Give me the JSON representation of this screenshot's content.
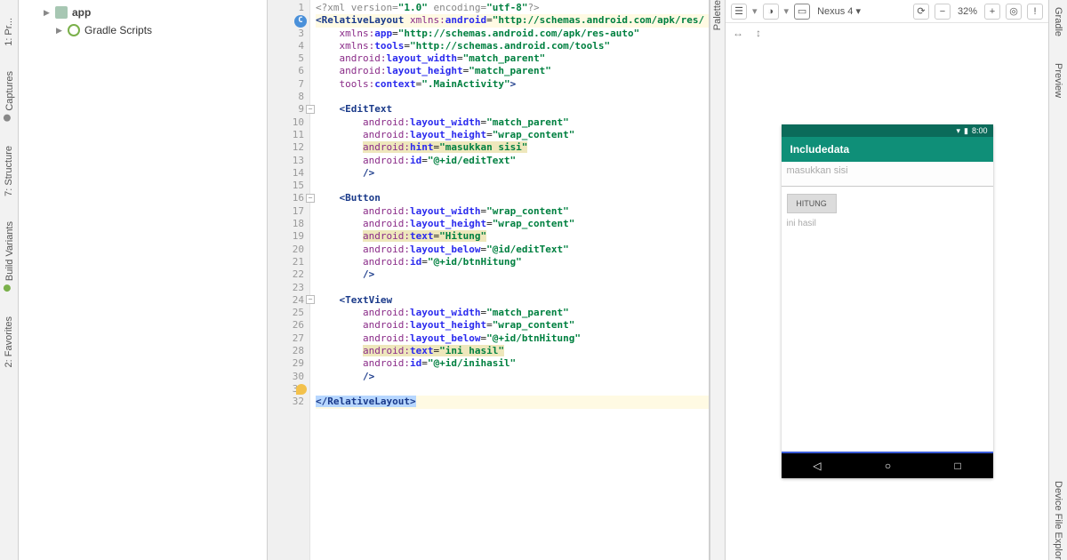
{
  "left_tabs": {
    "project": "1: Pr...",
    "captures": "Captures",
    "structure": "7: Structure",
    "build_variants": "Build Variants",
    "favorites": "2: Favorites"
  },
  "tree": {
    "app": "app",
    "gradle": "Gradle Scripts"
  },
  "palette": "Palette",
  "right_tabs": {
    "gradle": "Gradle",
    "preview": "Preview",
    "explorer": "Device File Explor"
  },
  "toolbar": {
    "device": "Nexus 4",
    "zoom": "32%",
    "layers_icon": "layers",
    "view_icon": "view",
    "phone_icon": "phone"
  },
  "preview": {
    "time": "8:00",
    "app_title": "Includedata",
    "hint": "masukkan sisi",
    "button": "HITUNG",
    "result": "ini hasil"
  },
  "code_lines": [
    {
      "n": 1,
      "html": "<span class='gr'>&lt;?xml version=</span><span class='val'>\"1.0\"</span><span class='gr'> encoding=</span><span class='val'>\"utf-8\"</span><span class='gr'>?&gt;</span>"
    },
    {
      "n": 2,
      "html": "<span class='tag'>&lt;RelativeLayout</span> <span class='attr-ns'>xmlns:</span><span class='attr'>android</span>=<span class='val'>\"http://schemas.android.com/apk/res/</span>",
      "hl": true,
      "anno": "c"
    },
    {
      "n": 3,
      "html": "    <span class='attr-ns'>xmlns:</span><span class='attr'>app</span>=<span class='val'>\"http://schemas.android.com/apk/res-auto\"</span>"
    },
    {
      "n": 4,
      "html": "    <span class='attr-ns'>xmlns:</span><span class='attr'>tools</span>=<span class='val'>\"http://schemas.android.com/tools\"</span>"
    },
    {
      "n": 5,
      "html": "    <span class='attr-ns'>android:</span><span class='attr'>layout_width</span>=<span class='val'>\"match_parent\"</span>"
    },
    {
      "n": 6,
      "html": "    <span class='attr-ns'>android:</span><span class='attr'>layout_height</span>=<span class='val'>\"match_parent\"</span>"
    },
    {
      "n": 7,
      "html": "    <span class='attr-ns'>tools:</span><span class='attr'>context</span>=<span class='val'>\".MainActivity\"</span><span class='tag'>&gt;</span>"
    },
    {
      "n": 8,
      "html": ""
    },
    {
      "n": 9,
      "html": "    <span class='tag'>&lt;EditText</span>",
      "fold": true
    },
    {
      "n": 10,
      "html": "        <span class='attr-ns'>android:</span><span class='attr'>layout_width</span>=<span class='val'>\"match_parent\"</span>"
    },
    {
      "n": 11,
      "html": "        <span class='attr-ns'>android:</span><span class='attr'>layout_height</span>=<span class='val'>\"wrap_content\"</span>"
    },
    {
      "n": 12,
      "html": "        <span class='hint-hl'><span class='attr-ns'>android:</span><span class='attr'>hint</span>=<span class='val'>\"masukkan sisi\"</span></span>"
    },
    {
      "n": 13,
      "html": "        <span class='attr-ns'>android:</span><span class='attr'>id</span>=<span class='val'>\"@+id/editText\"</span>"
    },
    {
      "n": 14,
      "html": "        <span class='tag'>/&gt;</span>"
    },
    {
      "n": 15,
      "html": ""
    },
    {
      "n": 16,
      "html": "    <span class='tag'>&lt;Button</span>",
      "fold": true
    },
    {
      "n": 17,
      "html": "        <span class='attr-ns'>android:</span><span class='attr'>layout_width</span>=<span class='val'>\"wrap_content\"</span>"
    },
    {
      "n": 18,
      "html": "        <span class='attr-ns'>android:</span><span class='attr'>layout_height</span>=<span class='val'>\"wrap_content\"</span>"
    },
    {
      "n": 19,
      "html": "        <span class='hint-hl'><span class='attr-ns'>android:</span><span class='attr'>text</span>=<span class='val'>\"Hitung\"</span></span>"
    },
    {
      "n": 20,
      "html": "        <span class='attr-ns'>android:</span><span class='attr'>layout_below</span>=<span class='val'>\"@id/editText\"</span>"
    },
    {
      "n": 21,
      "html": "        <span class='attr-ns'>android:</span><span class='attr'>id</span>=<span class='val'>\"@+id/btnHitung\"</span>"
    },
    {
      "n": 22,
      "html": "        <span class='tag'>/&gt;</span>"
    },
    {
      "n": 23,
      "html": ""
    },
    {
      "n": 24,
      "html": "    <span class='tag'>&lt;TextView</span>",
      "fold": true
    },
    {
      "n": 25,
      "html": "        <span class='attr-ns'>android:</span><span class='attr'>layout_width</span>=<span class='val'>\"match_parent\"</span>"
    },
    {
      "n": 26,
      "html": "        <span class='attr-ns'>android:</span><span class='attr'>layout_height</span>=<span class='val'>\"wrap_content\"</span>"
    },
    {
      "n": 27,
      "html": "        <span class='attr-ns'>android:</span><span class='attr'>layout_below</span>=<span class='val'>\"@+id/btnHitung\"</span>"
    },
    {
      "n": 28,
      "html": "        <span class='hint-hl'><span class='attr-ns'>android:</span><span class='attr'>text</span>=<span class='val'>\"ini hasil\"</span></span>"
    },
    {
      "n": 29,
      "html": "        <span class='attr-ns'>android:</span><span class='attr'>id</span>=<span class='val'>\"@+id/inihasil\"</span>"
    },
    {
      "n": 30,
      "html": "        <span class='tag'>/&gt;</span>"
    },
    {
      "n": 31,
      "html": "",
      "bulb": true
    },
    {
      "n": 32,
      "html": "<span class='sel'><span class='tag'>&lt;/RelativeLayout&gt;</span></span>",
      "hl": true
    }
  ]
}
